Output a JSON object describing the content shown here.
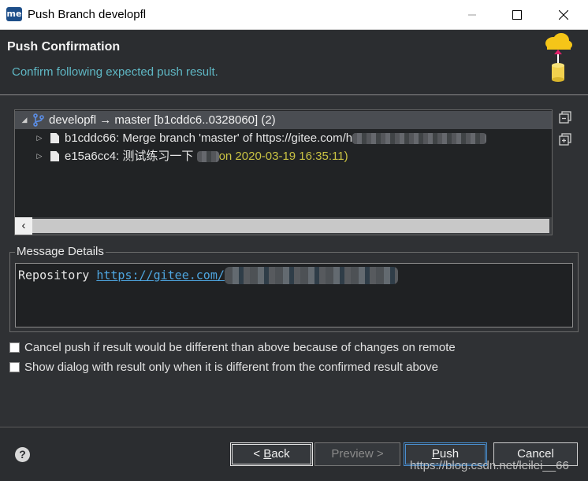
{
  "window": {
    "app_icon_text": "me",
    "title": "Push Branch developfl"
  },
  "header": {
    "title": "Push Confirmation",
    "subtitle": "Confirm following expected push result."
  },
  "tree": {
    "rows": [
      {
        "text": "developfl → master [b1cddc6..0328060] (2)"
      },
      {
        "text": "b1cddc66: Merge branch 'master' of https://gitee.com/h"
      },
      {
        "text": "e15a6cc4: 测试练习一下",
        "meta": "on 2020-03-19 16:35:11)"
      }
    ]
  },
  "message_details": {
    "legend": "Message Details",
    "prefix": "Repository ",
    "link": "https://gitee.com/"
  },
  "options": {
    "cancel_push_label": "Cancel push if result would be different than above because of changes on remote",
    "show_dialog_label": "Show dialog with result only when it is different from the confirmed result above"
  },
  "buttons": {
    "back": {
      "prefix": "< ",
      "mnemonic": "B",
      "rest": "ack"
    },
    "preview": "Preview >",
    "push": {
      "mnemonic": "P",
      "rest": "ush"
    },
    "cancel": "Cancel",
    "help_glyph": "?"
  },
  "watermark": "https://blog.csdn.net/leilei__66"
}
